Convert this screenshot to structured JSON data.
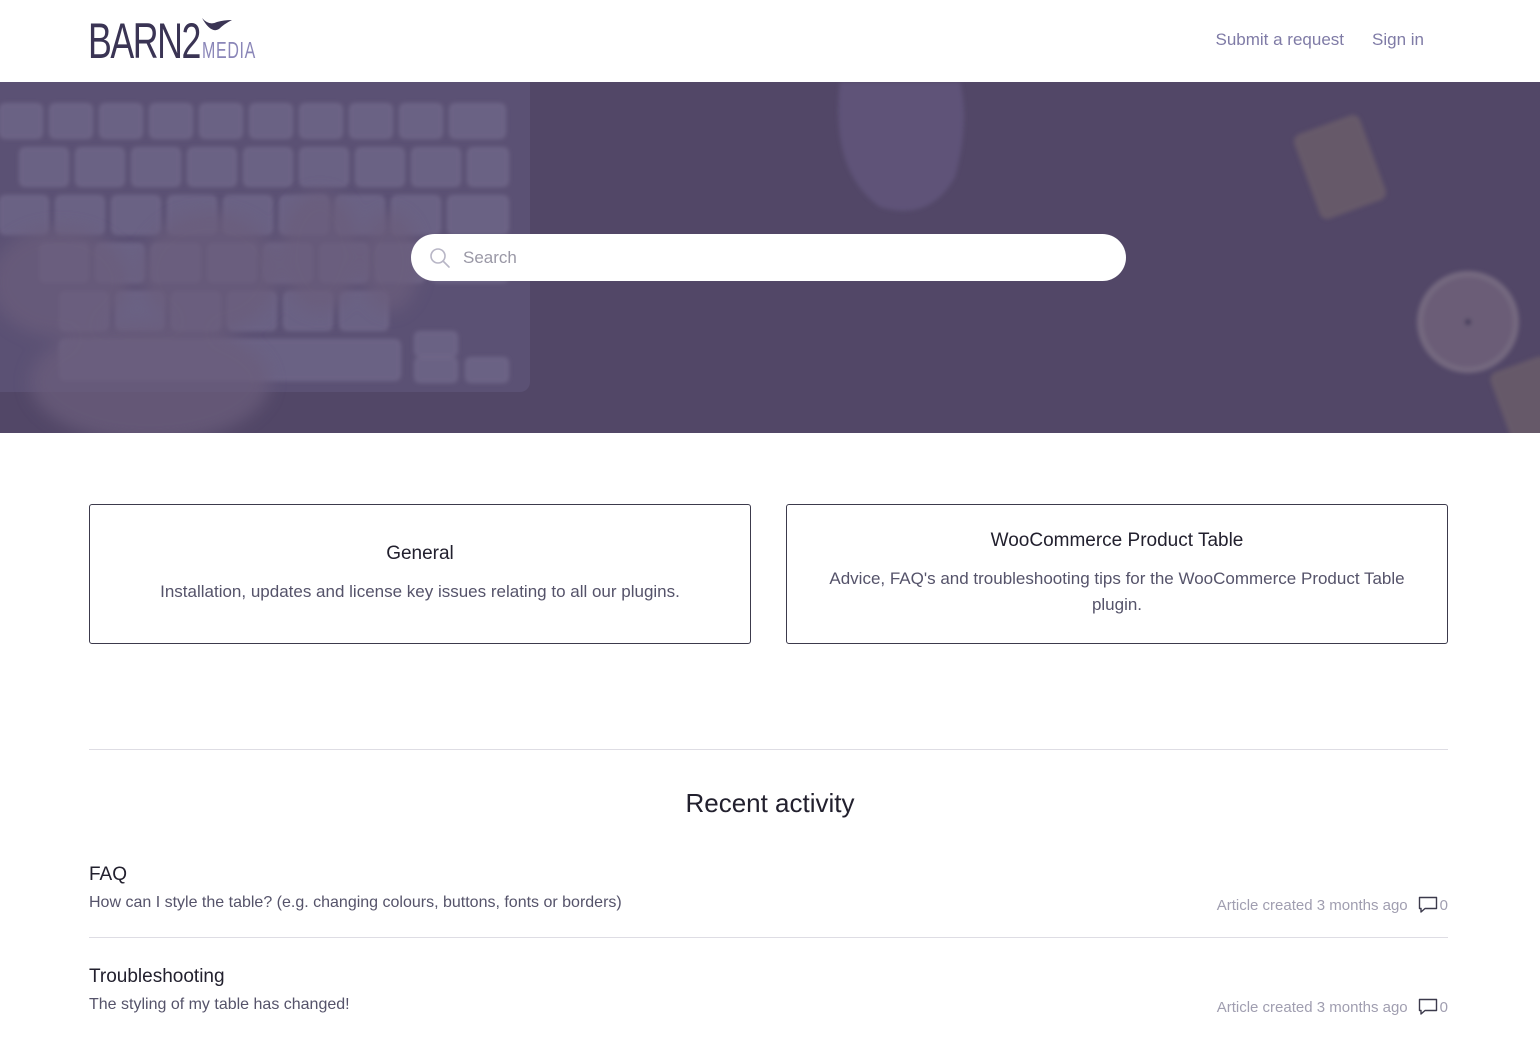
{
  "brand": {
    "name": "BARN2",
    "sub": "MEDIA",
    "color_primary": "#3a3454",
    "color_secondary": "#8a86b8"
  },
  "nav": {
    "submit_request": "Submit a request",
    "sign_in": "Sign in"
  },
  "search": {
    "placeholder": "Search"
  },
  "categories": [
    {
      "title": "General",
      "description": "Installation, updates and license key issues relating to all our plugins."
    },
    {
      "title": "WooCommerce Product Table",
      "description": "Advice, FAQ's and troubleshooting tips for the WooCommerce Product Table plugin."
    }
  ],
  "recent": {
    "heading": "Recent activity",
    "items": [
      {
        "category": "FAQ",
        "article": "How can I style the table? (e.g. changing colours, buttons, fonts or borders)",
        "meta": "Article created 3 months ago",
        "comments": "0"
      },
      {
        "category": "Troubleshooting",
        "article": "The styling of my table has changed!",
        "meta": "Article created 3 months ago",
        "comments": "0"
      }
    ]
  },
  "colors": {
    "hero": "#524767",
    "nav_link": "#7f7ba6"
  }
}
